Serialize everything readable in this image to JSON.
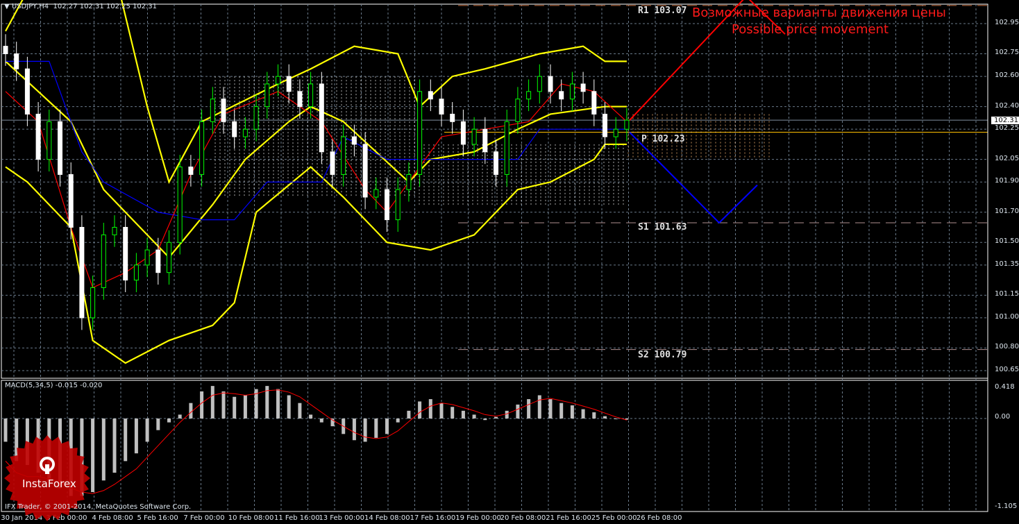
{
  "header": {
    "symbol": "USDJPY,H4",
    "ohlc": "102.27 102.31 102.25 102.31"
  },
  "current_price": "102.31",
  "price_axis": [
    "102.95",
    "102.75",
    "102.60",
    "102.40",
    "102.25",
    "102.05",
    "101.90",
    "101.70",
    "101.50",
    "101.35",
    "101.15",
    "101.00",
    "100.80",
    "100.65"
  ],
  "time_axis": [
    "30 Jan 2014",
    "3 Feb 00:00",
    "4 Feb 08:00",
    "5 Feb 16:00",
    "7 Feb 00:00",
    "10 Feb 08:00",
    "11 Feb 16:00",
    "13 Feb 00:00",
    "14 Feb 08:00",
    "17 Feb 16:00",
    "19 Feb 00:00",
    "20 Feb 08:00",
    "21 Feb 16:00",
    "25 Feb 00:00",
    "26 Feb 08:00"
  ],
  "pivots": {
    "r1": "R1  103.07",
    "p": "P  102.23",
    "s1": "S1  101.63",
    "s2": "S2  100.79"
  },
  "annotation": {
    "ru": "Возможные варианты движения цены",
    "en": "Possible price movement"
  },
  "macd": {
    "header": "MACD(5,34,5) -0.015 -0.020",
    "axis": [
      "0.418",
      "0.00",
      "-1.105"
    ]
  },
  "logo": {
    "text": "InstaForex"
  },
  "copyright": "IFX Trader, © 2001-2014, MetaQuotes Software Corp.",
  "colors": {
    "bull": "#00ff00",
    "bear": "#ffffff",
    "bands": "#ffff00",
    "kijun": "#0000ff",
    "tenkan": "#ff0000",
    "up_forecast": "#ff0000",
    "down_forecast": "#0000ff"
  },
  "chart_data": {
    "type": "candlestick",
    "title": "USDJPY,H4",
    "ylim": [
      100.6,
      103.1
    ],
    "closes": [
      102.75,
      102.65,
      102.35,
      102.05,
      102.3,
      101.95,
      101.6,
      101.0,
      101.2,
      101.55,
      101.6,
      101.25,
      101.35,
      101.45,
      101.3,
      101.5,
      102.0,
      101.95,
      102.3,
      102.45,
      102.3,
      102.2,
      102.25,
      102.4,
      102.55,
      102.6,
      102.5,
      102.4,
      102.55,
      102.1,
      101.95,
      102.2,
      102.15,
      101.8,
      101.85,
      101.65,
      101.85,
      101.95,
      102.5,
      102.45,
      102.35,
      102.3,
      102.15,
      102.25,
      102.1,
      101.95,
      102.3,
      102.45,
      102.5,
      102.6,
      102.5,
      102.45,
      102.55,
      102.5,
      102.35,
      102.2,
      102.25,
      102.31
    ],
    "bands_upper": [
      [
        0,
        102.9
      ],
      [
        3,
        103.3
      ],
      [
        10,
        103.3
      ],
      [
        13,
        102.4
      ],
      [
        15,
        101.9
      ],
      [
        18,
        102.3
      ],
      [
        25,
        102.55
      ],
      [
        28,
        102.65
      ],
      [
        32,
        102.8
      ],
      [
        36,
        102.75
      ],
      [
        38,
        102.4
      ],
      [
        41,
        102.6
      ],
      [
        44,
        102.65
      ],
      [
        49,
        102.75
      ],
      [
        53,
        102.8
      ],
      [
        55,
        102.7
      ],
      [
        57,
        102.7
      ]
    ],
    "bands_middle": [
      [
        0,
        102.7
      ],
      [
        6,
        102.3
      ],
      [
        9,
        101.85
      ],
      [
        15,
        101.4
      ],
      [
        19,
        101.75
      ],
      [
        22,
        102.05
      ],
      [
        26,
        102.3
      ],
      [
        28,
        102.4
      ],
      [
        31,
        102.3
      ],
      [
        37,
        101.9
      ],
      [
        39,
        102.05
      ],
      [
        43,
        102.1
      ],
      [
        47,
        102.25
      ],
      [
        50,
        102.35
      ],
      [
        55,
        102.4
      ],
      [
        57,
        102.4
      ]
    ],
    "bands_lower": [
      [
        0,
        102.0
      ],
      [
        2,
        101.9
      ],
      [
        6,
        101.6
      ],
      [
        8,
        100.85
      ],
      [
        11,
        100.7
      ],
      [
        15,
        100.85
      ],
      [
        19,
        100.95
      ],
      [
        21,
        101.1
      ],
      [
        23,
        101.7
      ],
      [
        28,
        102.0
      ],
      [
        31,
        101.8
      ],
      [
        35,
        101.5
      ],
      [
        39,
        101.45
      ],
      [
        43,
        101.55
      ],
      [
        47,
        101.85
      ],
      [
        50,
        101.9
      ],
      [
        54,
        102.05
      ],
      [
        55,
        102.15
      ],
      [
        57,
        102.15
      ]
    ],
    "kijun": [
      [
        0,
        102.7
      ],
      [
        4,
        102.7
      ],
      [
        7,
        102.1
      ],
      [
        9,
        101.9
      ],
      [
        14,
        101.7
      ],
      [
        18,
        101.65
      ],
      [
        21,
        101.65
      ],
      [
        24,
        101.9
      ],
      [
        29,
        101.9
      ],
      [
        31,
        102.2
      ],
      [
        35,
        102.05
      ],
      [
        47,
        102.05
      ],
      [
        49,
        102.25
      ],
      [
        57,
        102.25
      ]
    ],
    "tenkan": [
      [
        0,
        102.5
      ],
      [
        3,
        102.3
      ],
      [
        6,
        101.6
      ],
      [
        8,
        101.2
      ],
      [
        11,
        101.3
      ],
      [
        14,
        101.45
      ],
      [
        17,
        101.95
      ],
      [
        20,
        102.35
      ],
      [
        25,
        102.5
      ],
      [
        29,
        102.3
      ],
      [
        33,
        101.85
      ],
      [
        35,
        101.7
      ],
      [
        37,
        101.9
      ],
      [
        40,
        102.2
      ],
      [
        44,
        102.25
      ],
      [
        48,
        102.3
      ],
      [
        51,
        102.55
      ],
      [
        54,
        102.5
      ],
      [
        57,
        102.3
      ]
    ],
    "forecast_up": [
      [
        102.31
      ],
      [
        103.15
      ],
      [
        102.9
      ]
    ],
    "forecast_down": [
      [
        102.23
      ],
      [
        101.63
      ],
      [
        101.88
      ]
    ],
    "macd_hist": [
      -0.3,
      -0.55,
      -0.6,
      -0.7,
      -0.8,
      -0.9,
      -1.0,
      -1.0,
      -0.95,
      -0.8,
      -0.7,
      -0.55,
      -0.45,
      -0.3,
      -0.15,
      -0.05,
      0.05,
      0.2,
      0.35,
      0.42,
      0.35,
      0.28,
      0.3,
      0.38,
      0.42,
      0.38,
      0.3,
      0.2,
      0.05,
      -0.05,
      -0.1,
      -0.2,
      -0.28,
      -0.3,
      -0.25,
      -0.2,
      -0.05,
      0.1,
      0.22,
      0.25,
      0.2,
      0.15,
      0.1,
      0.05,
      -0.02,
      0.02,
      0.1,
      0.18,
      0.25,
      0.3,
      0.25,
      0.2,
      0.17,
      0.12,
      0.08,
      0.03,
      0.0,
      -0.015
    ],
    "macd_signal": [
      -0.55,
      -0.7,
      -0.75,
      -0.75,
      -0.78,
      -0.82,
      -0.9,
      -0.95,
      -0.97,
      -0.93,
      -0.85,
      -0.75,
      -0.65,
      -0.5,
      -0.35,
      -0.2,
      -0.05,
      0.08,
      0.2,
      0.3,
      0.33,
      0.32,
      0.3,
      0.32,
      0.36,
      0.37,
      0.34,
      0.28,
      0.18,
      0.08,
      -0.02,
      -0.1,
      -0.18,
      -0.24,
      -0.26,
      -0.24,
      -0.16,
      -0.04,
      0.08,
      0.16,
      0.2,
      0.18,
      0.14,
      0.1,
      0.05,
      0.03,
      0.06,
      0.12,
      0.18,
      0.24,
      0.26,
      0.23,
      0.2,
      0.16,
      0.12,
      0.07,
      0.02,
      -0.02
    ],
    "macd_ylim": [
      -1.105,
      0.418
    ]
  }
}
